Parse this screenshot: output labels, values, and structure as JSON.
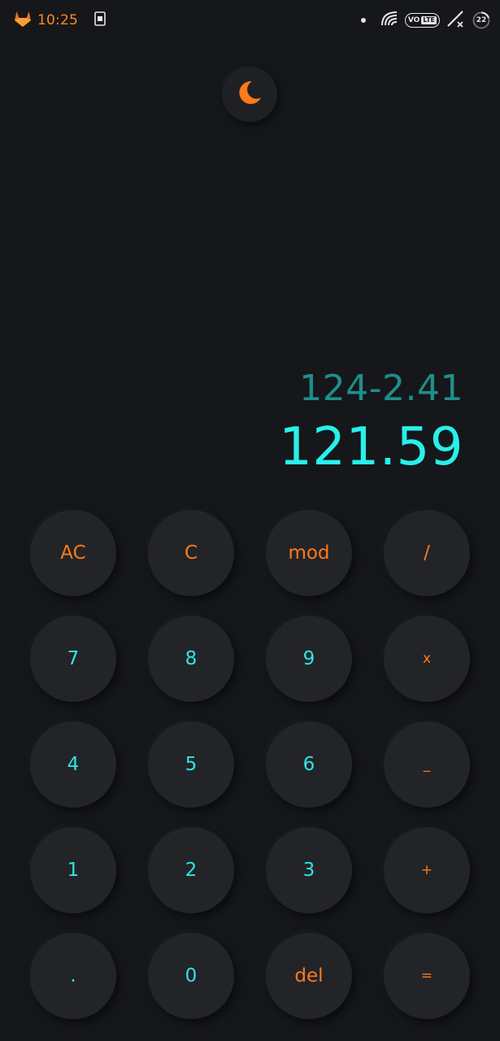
{
  "status_bar": {
    "time": "10:25",
    "battery_level": "22",
    "network_label_vo": "VO",
    "network_label_lte": "LTE",
    "icons": [
      "gitlab-fox-icon",
      "sim-card-icon",
      "notification-dot-icon",
      "wifi-signal-icon",
      "volte-icon",
      "cellular-no-signal-icon",
      "battery-circle-icon"
    ]
  },
  "theme_toggle": {
    "icon": "moon-icon",
    "color": "#ff7a1a"
  },
  "display": {
    "expression": "124-2.41",
    "result": "121.59",
    "expression_color": "#1d8f8a",
    "result_color": "#28f0ea"
  },
  "keypad": {
    "rows": [
      [
        {
          "label": "AC",
          "color": "orange"
        },
        {
          "label": "C",
          "color": "orange"
        },
        {
          "label": "mod",
          "color": "orange"
        },
        {
          "label": "/",
          "color": "orange"
        }
      ],
      [
        {
          "label": "7",
          "color": "cyan"
        },
        {
          "label": "8",
          "color": "cyan"
        },
        {
          "label": "9",
          "color": "cyan"
        },
        {
          "label": "x",
          "color": "orange"
        }
      ],
      [
        {
          "label": "4",
          "color": "cyan"
        },
        {
          "label": "5",
          "color": "cyan"
        },
        {
          "label": "6",
          "color": "cyan"
        },
        {
          "label": "_",
          "color": "orange"
        }
      ],
      [
        {
          "label": "1",
          "color": "cyan"
        },
        {
          "label": "2",
          "color": "cyan"
        },
        {
          "label": "3",
          "color": "cyan"
        },
        {
          "label": "+",
          "color": "orange"
        }
      ],
      [
        {
          "label": ".",
          "color": "cyan"
        },
        {
          "label": "0",
          "color": "cyan"
        },
        {
          "label": "del",
          "color": "orange"
        },
        {
          "label": "=",
          "color": "orange"
        }
      ]
    ]
  },
  "colors": {
    "background": "#15171a",
    "key_background": "#222428",
    "accent_orange": "#ff7a1a",
    "accent_cyan": "#2ee6e1"
  }
}
